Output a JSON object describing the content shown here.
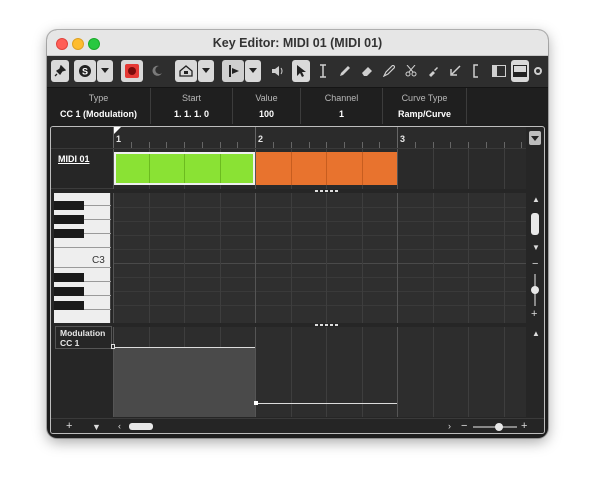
{
  "window": {
    "title": "Key Editor: MIDI 01 (MIDI 01)"
  },
  "toolbar": {
    "icons": [
      "pin-icon",
      "solo-icon",
      "record-icon",
      "moon-icon",
      "auto-scroll-icon",
      "snap-icon",
      "speaker-icon",
      "pointer-icon",
      "range-icon",
      "pencil-icon",
      "eraser-icon",
      "draw-icon",
      "scissors-icon",
      "glue-icon",
      "arrow-icon",
      "bracket-icon",
      "panel-left-icon",
      "panel-bottom-icon",
      "settings-icon"
    ]
  },
  "infoline": {
    "columns": [
      {
        "label": "Type",
        "value": "CC 1  (Modulation)"
      },
      {
        "label": "Start",
        "value": "1.  1.  1.    0"
      },
      {
        "label": "Value",
        "value": "100"
      },
      {
        "label": "Channel",
        "value": "1"
      },
      {
        "label": "Curve Type",
        "value": "Ramp/Curve"
      }
    ]
  },
  "ruler": {
    "markers": [
      "1",
      "2",
      "3"
    ]
  },
  "track": {
    "name": "MIDI 01"
  },
  "keyboard": {
    "label": "C3"
  },
  "controller": {
    "name": "Modulation",
    "cc": "CC 1"
  },
  "parts": [
    {
      "color": "#8ae234",
      "border": "#f0f0f0"
    },
    {
      "color": "#e8732e",
      "border": "#e8732e"
    }
  ],
  "colors": {
    "background": "#1e1e1e",
    "accent": "#8ae234",
    "part2": "#e8732e",
    "record": "#e53935"
  }
}
